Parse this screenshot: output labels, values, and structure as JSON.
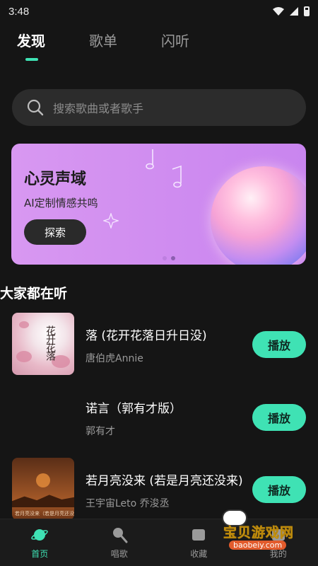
{
  "status_bar": {
    "time": "3:48"
  },
  "tabs": [
    {
      "label": "发现",
      "active": true
    },
    {
      "label": "歌单",
      "active": false
    },
    {
      "label": "闪听",
      "active": false
    }
  ],
  "search": {
    "placeholder": "搜索歌曲或者歌手",
    "icon": "search-icon"
  },
  "banner": {
    "title": "心灵声域",
    "subtitle": "AI定制情感共鸣",
    "button_label": "探索",
    "page_count": 2,
    "active_page": 2
  },
  "section": {
    "title": "大家都在听"
  },
  "songs": [
    {
      "title": "落 (花开花落日升日没)",
      "artist": "唐伯虎Annie",
      "play_label": "播放",
      "cover_calligraphy": "花开花落"
    },
    {
      "title": "诺言（郭有才版）",
      "artist": "郭有才",
      "play_label": "播放"
    },
    {
      "title": "若月亮没来 (若是月亮还没来)",
      "artist": "王宇宙Leto 乔浚丞",
      "play_label": "播放",
      "cover_text": "若月亮没来（若是月亮还没来）"
    }
  ],
  "bottom_nav": [
    {
      "label": "首页",
      "icon": "planet-icon",
      "active": true
    },
    {
      "label": "唱歌",
      "icon": "microphone-icon",
      "active": false
    },
    {
      "label": "收藏",
      "icon": "collect-icon",
      "active": false
    },
    {
      "label": "我的",
      "icon": "user-icon",
      "active": false
    }
  ],
  "watermark": {
    "text": "宝贝游戏网",
    "url": "baobeiy.com"
  },
  "colors": {
    "accent": "#3fe2b4",
    "background": "#151515",
    "banner": "#d898f1"
  }
}
